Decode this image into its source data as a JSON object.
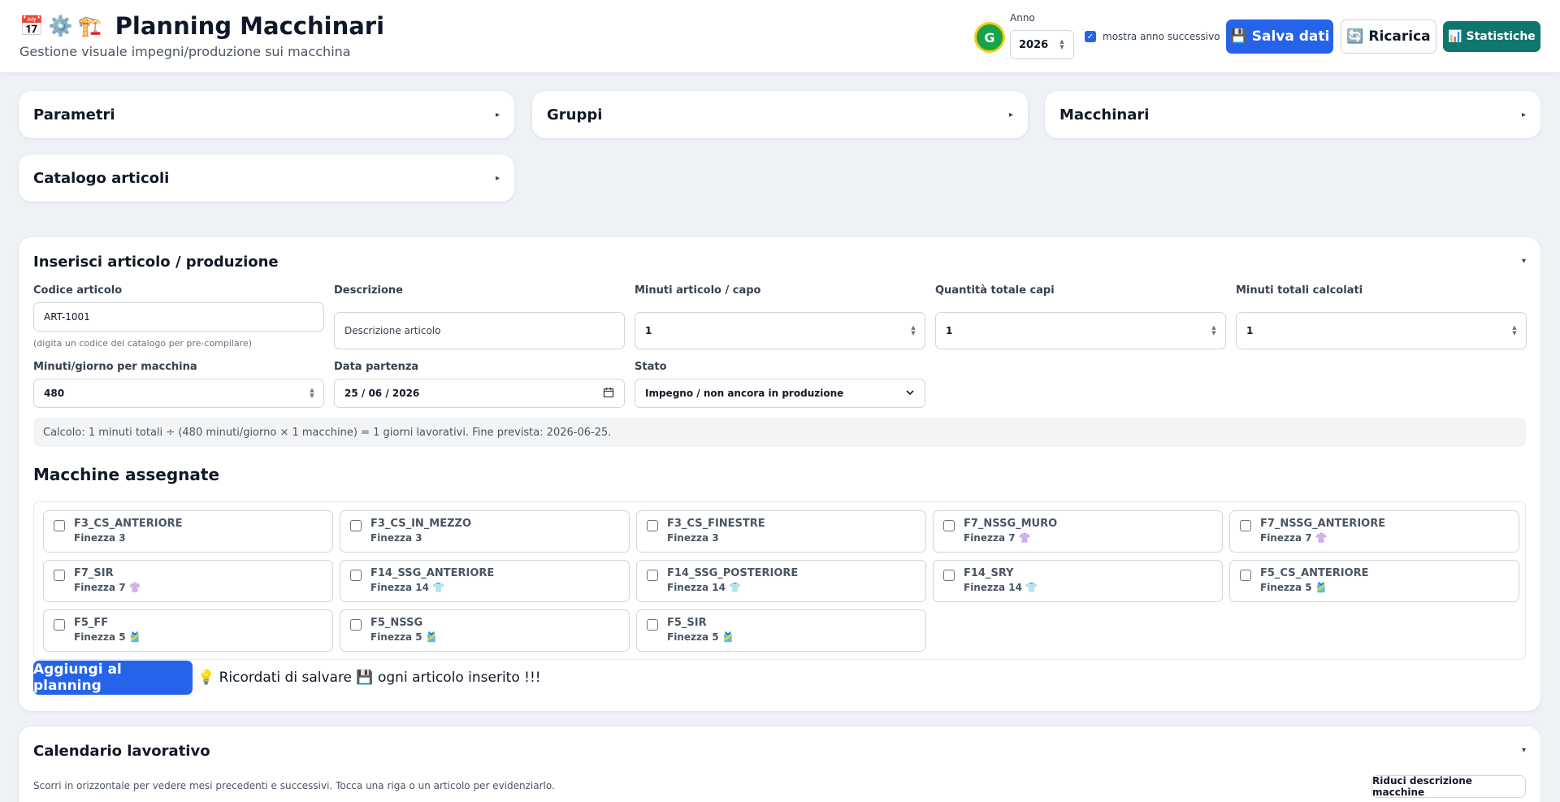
{
  "header": {
    "icons": [
      "calendar-icon",
      "gear-icon",
      "crane-icon"
    ],
    "icon_glyphs": [
      "📅",
      "⚙️",
      "🏗️"
    ],
    "title": "Planning Macchinari",
    "subtitle": "Gestione visuale impegni/produzione sui macchina",
    "avatar_initial": "G",
    "year_label": "Anno",
    "year_value": "2026",
    "show_next_year_label": "mostra anno successivo",
    "show_next_year_checked": true,
    "save_label": "💾 Salva dati",
    "reload_label": "🔄 Ricarica",
    "stats_label": "📊 Statistiche"
  },
  "panels": {
    "parametri": "Parametri",
    "gruppi": "Gruppi",
    "macchinari": "Macchinari",
    "catalogo": "Catalogo articoli",
    "arrow": "▸"
  },
  "form": {
    "title": "Inserisci articolo / produzione",
    "toggle": "▾",
    "codice_label": "Codice articolo",
    "codice_value": "ART-1001",
    "codice_hint": "(digita un codice del catalogo per pre-compilare)",
    "descrizione_label": "Descrizione",
    "descrizione_placeholder": "Descrizione articolo",
    "minuti_capo_label": "Minuti articolo / capo",
    "minuti_capo_value": "1",
    "quantita_label": "Quantità totale capi",
    "quantita_value": "1",
    "minuti_totali_label": "Minuti totali calcolati",
    "minuti_totali_value": "1",
    "minuti_giorno_label": "Minuti/giorno per macchina",
    "minuti_giorno_value": "480",
    "data_label": "Data partenza",
    "data_value": "25 / 06 / 2026",
    "stato_label": "Stato",
    "stato_value": "Impegno / non ancora in produzione",
    "calcolo": "Calcolo: 1 minuti totali ÷ (480 minuti/giorno × 1 macchine) = 1 giorni lavorativi. Fine prevista: 2026-06-25.",
    "machines_title": "Macchine assegnate",
    "machines": [
      {
        "name": "F3_CS_ANTERIORE",
        "fin": "Finezza 3"
      },
      {
        "name": "F3_CS_IN_MEZZO",
        "fin": "Finezza 3"
      },
      {
        "name": "F3_CS_FINESTRE",
        "fin": "Finezza 3"
      },
      {
        "name": "F7_NSSG_MURO",
        "fin": "Finezza 7 👚"
      },
      {
        "name": "F7_NSSG_ANTERIORE",
        "fin": "Finezza 7 👚"
      },
      {
        "name": "F7_SIR",
        "fin": "Finezza 7 👚"
      },
      {
        "name": "F14_SSG_ANTERIORE",
        "fin": "Finezza 14 👕"
      },
      {
        "name": "F14_SSG_POSTERIORE",
        "fin": "Finezza 14 👕"
      },
      {
        "name": "F14_SRY",
        "fin": "Finezza 14 👕"
      },
      {
        "name": "F5_CS_ANTERIORE",
        "fin": "Finezza 5 🎽"
      },
      {
        "name": "F5_FF",
        "fin": "Finezza 5 🎽"
      },
      {
        "name": "F5_NSSG",
        "fin": "Finezza 5 🎽"
      },
      {
        "name": "F5_SIR",
        "fin": "Finezza 5 🎽"
      }
    ],
    "add_label": "Aggiungi al planning",
    "reminder": "💡 Ricordati di salvare 💾 ogni articolo inserito !!!"
  },
  "calendar": {
    "title": "Calendario lavorativo",
    "toggle": "▾",
    "description": "Scorri in orizzontale per vedere mesi precedenti e successivi. Tocca una riga o un articolo per evidenziarlo.",
    "reduce_label": "Riduci descrizione macchine"
  },
  "colors": {
    "primary": "#2563eb",
    "stats": "#0f766e",
    "avatar": "#16a34a",
    "avatar_ring": "#facc15",
    "background": "#eef1f6"
  }
}
